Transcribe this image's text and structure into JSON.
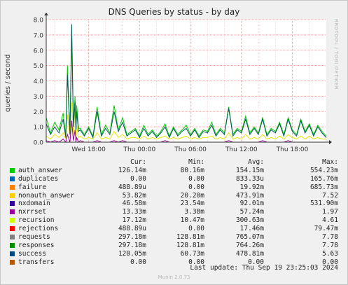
{
  "title": "DNS Queries by status - by day",
  "ylabel": "queries / second",
  "side_text": "RRDTOOL / TOBI OETIKER",
  "chart_data": {
    "type": "line",
    "title": "DNS Queries by status - by day",
    "ylabel": "queries / second",
    "ylim": [
      0,
      8
    ],
    "y_ticks": [
      "0.0",
      "1.0",
      "2.0",
      "3.0",
      "4.0",
      "5.0",
      "6.0",
      "7.0",
      "8.0"
    ],
    "x_tick_labels": [
      "Wed 18:00",
      "Thu 00:00",
      "Thu 06:00",
      "Thu 12:00",
      "Thu 18:00"
    ],
    "grid": true,
    "x_hours": [
      0,
      0.5,
      1,
      1.5,
      2,
      2.3,
      2.5,
      2.8,
      3,
      3.2,
      3.4,
      3.5,
      3.6,
      3.8,
      4,
      4.5,
      5,
      5.5,
      6,
      6.5,
      7,
      7.5,
      8,
      8.5,
      9,
      9.5,
      10,
      10.5,
      11,
      11.5,
      12,
      12.5,
      13,
      13.5,
      14,
      14.5,
      15,
      15.5,
      16,
      16.5,
      17,
      17.5,
      18,
      18.5,
      19,
      19.5,
      20,
      20.5,
      21,
      21.5,
      22,
      22.5,
      23,
      23.5,
      24,
      24.5,
      25,
      25.5,
      26,
      26.5,
      27,
      27.5,
      28,
      28.5,
      29,
      29.5,
      30,
      30.5,
      31,
      31.5,
      32,
      32.5,
      33
    ],
    "series": [
      {
        "name": "auth_answer",
        "color": "#00cc00",
        "values": [
          1.6,
          0.6,
          1.3,
          0.8,
          1.9,
          0.4,
          5.0,
          0.6,
          6.8,
          1.2,
          3.0,
          1.0,
          2.4,
          0.9,
          0.9,
          0.5,
          1.0,
          0.4,
          2.3,
          0.5,
          1.1,
          0.6,
          2.4,
          0.8,
          1.6,
          0.5,
          0.7,
          0.9,
          0.4,
          1.1,
          0.5,
          0.8,
          0.4,
          0.7,
          1.2,
          0.4,
          1.0,
          0.5,
          0.8,
          1.1,
          0.5,
          0.9,
          0.4,
          0.8,
          0.7,
          1.3,
          0.5,
          0.9,
          0.6,
          2.3,
          0.5,
          0.9,
          0.7,
          1.7,
          0.6,
          1.0,
          0.6,
          1.6,
          0.5,
          0.9,
          0.7,
          1.3,
          0.5,
          1.6,
          0.8,
          0.5,
          1.5,
          0.7,
          1.2,
          0.5,
          1.1,
          0.7,
          0.4
        ]
      },
      {
        "name": "nonauth_answer",
        "color": "#e6e600",
        "values": [
          0.4,
          0.2,
          0.5,
          0.3,
          0.6,
          0.2,
          1.8,
          0.3,
          2.6,
          0.5,
          2.2,
          0.4,
          1.1,
          0.3,
          0.4,
          0.2,
          0.3,
          0.2,
          0.6,
          0.2,
          0.3,
          0.2,
          0.7,
          0.3,
          0.5,
          0.2,
          0.3,
          0.3,
          0.2,
          0.4,
          0.2,
          0.3,
          0.2,
          0.3,
          0.4,
          0.2,
          0.3,
          0.2,
          0.3,
          0.4,
          0.2,
          0.3,
          0.2,
          0.3,
          0.3,
          0.4,
          0.2,
          0.3,
          0.2,
          0.6,
          0.2,
          0.3,
          0.2,
          0.5,
          0.2,
          0.3,
          0.2,
          0.5,
          0.2,
          0.3,
          0.2,
          0.4,
          0.2,
          0.5,
          0.3,
          0.2,
          0.4,
          0.2,
          0.4,
          0.2,
          0.3,
          0.2,
          0.2
        ]
      },
      {
        "name": "responses",
        "color": "#005a5a",
        "values": [
          1.2,
          0.5,
          1.0,
          0.6,
          1.5,
          0.3,
          4.4,
          0.5,
          7.7,
          1.0,
          2.6,
          0.8,
          2.0,
          0.7,
          0.8,
          0.4,
          0.9,
          0.3,
          2.0,
          0.4,
          0.9,
          0.5,
          2.0,
          0.7,
          1.3,
          0.4,
          0.6,
          0.8,
          0.3,
          0.9,
          0.4,
          0.7,
          0.3,
          0.6,
          1.0,
          0.3,
          0.9,
          0.4,
          0.7,
          0.9,
          0.4,
          0.8,
          0.3,
          0.7,
          0.6,
          1.1,
          0.4,
          0.8,
          0.5,
          2.2,
          0.4,
          0.8,
          0.6,
          1.5,
          0.5,
          0.9,
          0.5,
          1.5,
          0.4,
          0.8,
          0.6,
          1.2,
          0.4,
          1.5,
          0.7,
          0.4,
          1.4,
          0.6,
          1.1,
          0.4,
          1.0,
          0.6,
          0.3
        ]
      },
      {
        "name": "nxrrset",
        "color": "#990099",
        "values": [
          0.1,
          0.0,
          0.1,
          0.0,
          0.2,
          0.0,
          0.5,
          0.0,
          1.4,
          0.1,
          0.8,
          0.0,
          0.3,
          0.0,
          0.1,
          0.0,
          0.0,
          0.0,
          0.1,
          0.0,
          0.0,
          0.0,
          0.1,
          0.0,
          0.1,
          0.0,
          0.0,
          0.0,
          0.0,
          0.0,
          0.0,
          0.0,
          0.0,
          0.0,
          0.1,
          0.0,
          0.0,
          0.0,
          0.0,
          0.0,
          0.0,
          0.0,
          0.0,
          0.0,
          0.0,
          0.0,
          0.0,
          0.0,
          0.0,
          0.1,
          0.0,
          0.0,
          0.0,
          0.0,
          0.0,
          0.0,
          0.0,
          0.1,
          0.0,
          0.0,
          0.0,
          0.0,
          0.0,
          0.1,
          0.0,
          0.0,
          0.0,
          0.0,
          0.0,
          0.0,
          0.0,
          0.0,
          0.0
        ]
      }
    ]
  },
  "legend": {
    "headers": {
      "cur": "Cur:",
      "min": "Min:",
      "avg": "Avg:",
      "max": "Max:"
    },
    "rows": [
      {
        "name": "auth_answer",
        "color": "#00cc00",
        "cur": "126.14m",
        "min": "80.16m",
        "avg": "154.15m",
        "max": "554.23m"
      },
      {
        "name": "duplicates",
        "color": "#0066b3",
        "cur": "0.00",
        "min": "0.00",
        "avg": "833.33u",
        "max": "165.76m"
      },
      {
        "name": "failure",
        "color": "#ff8000",
        "cur": "488.89u",
        "min": "0.00",
        "avg": "19.92m",
        "max": "685.73m"
      },
      {
        "name": "nonauth_answer",
        "color": "#ffcc00",
        "cur": "53.82m",
        "min": "20.20m",
        "avg": "473.91m",
        "max": "7.52"
      },
      {
        "name": "nxdomain",
        "color": "#330099",
        "cur": "46.58m",
        "min": "23.54m",
        "avg": "92.01m",
        "max": "531.90m"
      },
      {
        "name": "nxrrset",
        "color": "#990099",
        "cur": "13.33m",
        "min": "3.38m",
        "avg": "57.24m",
        "max": "1.97"
      },
      {
        "name": "recursion",
        "color": "#ccff00",
        "cur": "17.12m",
        "min": "10.47m",
        "avg": "300.63m",
        "max": "4.61"
      },
      {
        "name": "rejections",
        "color": "#ff0000",
        "cur": "488.89u",
        "min": "0.00",
        "avg": "17.46m",
        "max": "79.47m"
      },
      {
        "name": "requests",
        "color": "#808080",
        "cur": "297.18m",
        "min": "128.81m",
        "avg": "765.07m",
        "max": "7.78"
      },
      {
        "name": "responses",
        "color": "#008f00",
        "cur": "297.18m",
        "min": "128.81m",
        "avg": "764.26m",
        "max": "7.78"
      },
      {
        "name": "success",
        "color": "#00487d",
        "cur": "120.05m",
        "min": "60.73m",
        "avg": "478.81m",
        "max": "5.63"
      },
      {
        "name": "transfers",
        "color": "#b35a00",
        "cur": "0.00",
        "min": "0.00",
        "avg": "0.00",
        "max": "0.00"
      }
    ]
  },
  "last_update": "Last update:  Thu Sep 19 23:25:03 2024",
  "footer": "Munin 2.0.73"
}
